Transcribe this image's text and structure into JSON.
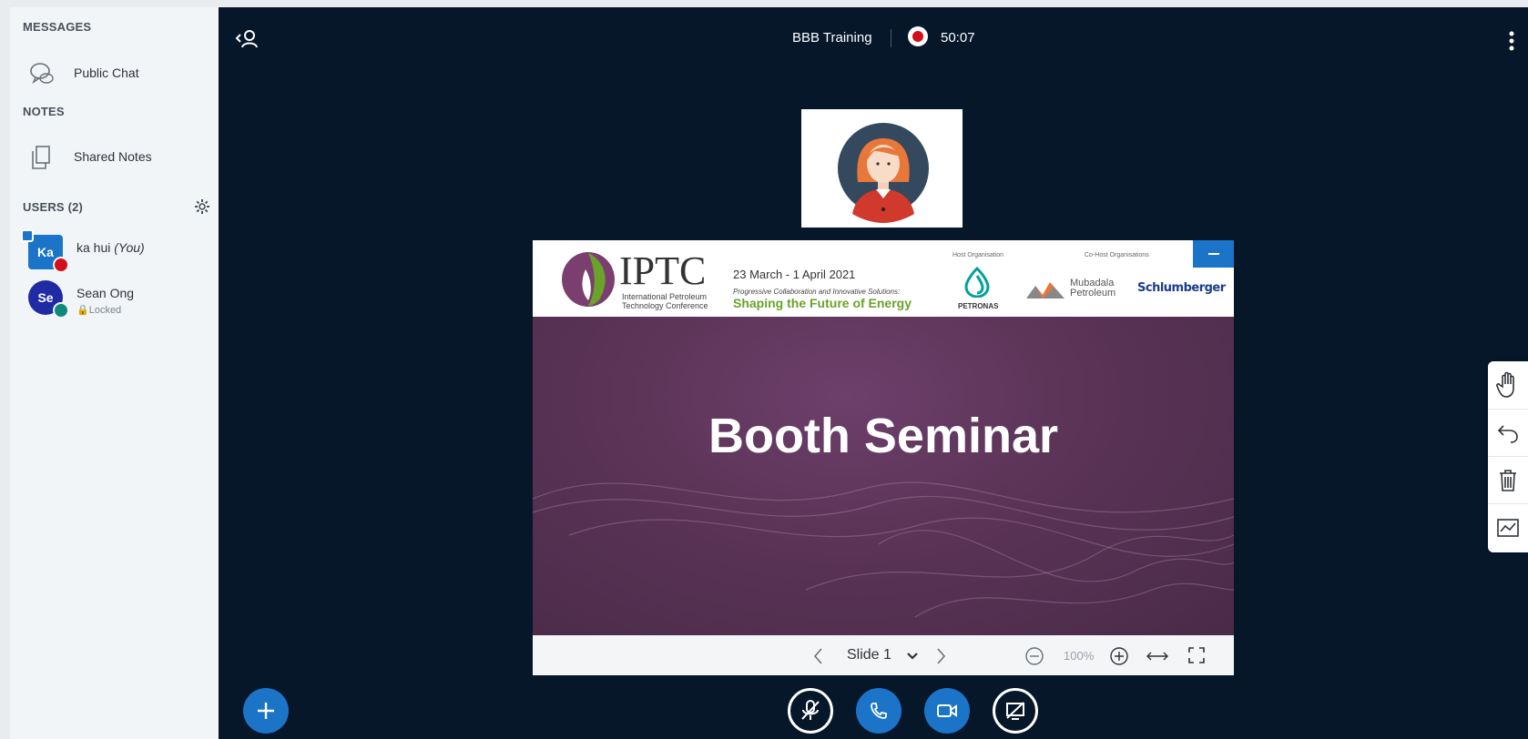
{
  "sidebar": {
    "messages_title": "MESSAGES",
    "public_chat": "Public Chat",
    "notes_title": "NOTES",
    "shared_notes": "Shared Notes",
    "users_title": "USERS (2)",
    "users": [
      {
        "initials": "Ka",
        "name": "ka hui",
        "you": "(You)",
        "status": ""
      },
      {
        "initials": "Se",
        "name": "Sean Ong",
        "you": "",
        "status": "Locked"
      }
    ]
  },
  "topbar": {
    "meeting_title": "BBB Training",
    "recording_time": "50:07"
  },
  "presentation": {
    "header": {
      "logo_text": "IPTC",
      "logo_sub1": "International Petroleum",
      "logo_sub2": "Technology Conference",
      "dates": "23 March - 1 April 2021",
      "tagline_small": "Progressive Collaboration and Innovative Solutions:",
      "tagline_big": "Shaping the Future of Energy",
      "host_label": "Host Organisation",
      "cohost_label": "Co-Host Organisations",
      "host_name": "PETRONAS",
      "cohost1_line1": "Mubadala",
      "cohost1_line2": "Petroleum",
      "cohost2": "Schlumberger"
    },
    "slide_title": "Booth Seminar",
    "footer": {
      "slide_label": "Slide 1",
      "zoom": "100%"
    }
  },
  "colors": {
    "accent": "#1b74c8",
    "main_bg": "#06172a",
    "slide_purple": "#5a3356",
    "record_red": "#d40d1a",
    "petronas_teal": "#00a19c",
    "tagline_green": "#6aa22a"
  }
}
